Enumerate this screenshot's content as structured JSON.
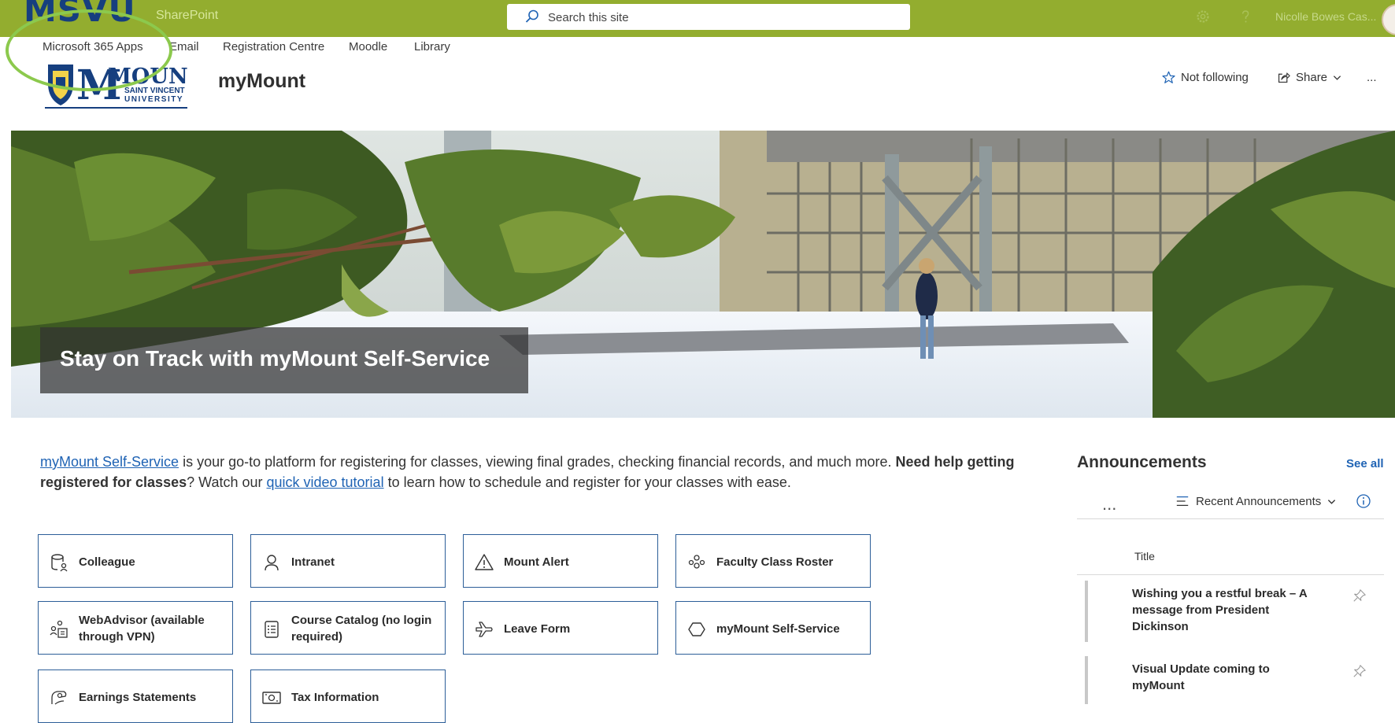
{
  "suite_bar": {
    "brand_logo": "MSVU",
    "app_name": "SharePoint",
    "search_placeholder": "Search this site",
    "user_name": "Nicolle Bowes Cas..."
  },
  "hub_nav": [
    {
      "label": "Microsoft 365 Apps"
    },
    {
      "label": "Email"
    },
    {
      "label": "Registration Centre"
    },
    {
      "label": "Moodle"
    },
    {
      "label": "Library"
    }
  ],
  "site_header": {
    "logo": {
      "line1": "MOUNT",
      "line2": "SAINT VINCENT",
      "line3": "UNIVERSITY"
    },
    "title": "myMount",
    "follow_label": "Not following",
    "share_label": "Share",
    "more_label": "..."
  },
  "hero": {
    "caption": "Stay on Track with myMount Self-Service"
  },
  "intro": {
    "link1": "myMount Self-Service",
    "text1": " is your go-to platform for registering for classes, viewing final grades, checking financial records, and much more. ",
    "bold": "Need help getting registered for classes",
    "text2": "? Watch our ",
    "link2": "quick video tutorial",
    "text3": " to learn how to schedule and register for your classes with ease."
  },
  "quick_links": [
    {
      "label": "Colleague",
      "icon": "database-user-icon"
    },
    {
      "label": "Intranet",
      "icon": "person-icon"
    },
    {
      "label": "Mount Alert",
      "icon": "warning-icon"
    },
    {
      "label": "Faculty Class Roster",
      "icon": "people-group-icon"
    },
    {
      "label": "WebAdvisor (available through VPN)",
      "icon": "people-building-icon"
    },
    {
      "label": "Course Catalog (no login required)",
      "icon": "list-document-icon"
    },
    {
      "label": "Leave Form",
      "icon": "airplane-icon"
    },
    {
      "label": "myMount Self-Service",
      "icon": "hexagon-icon"
    },
    {
      "label": "Earnings Statements",
      "icon": "money-hand-icon"
    },
    {
      "label": "Tax Information",
      "icon": "money-icon"
    }
  ],
  "announcements": {
    "title": "Announcements",
    "see_all": "See all",
    "more": "...",
    "view_label": "Recent Announcements",
    "column_title": "Title",
    "items": [
      {
        "title": "Wishing you a restful break – A message from President Dickinson"
      },
      {
        "title": "Visual Update coming to myMount"
      }
    ]
  },
  "colors": {
    "suite_bar": "#93ad2f",
    "brand_navy": "#163f7f",
    "link_blue": "#1f63b4",
    "tile_border": "#2c5e98",
    "annotation_circle": "#8cc94d"
  }
}
